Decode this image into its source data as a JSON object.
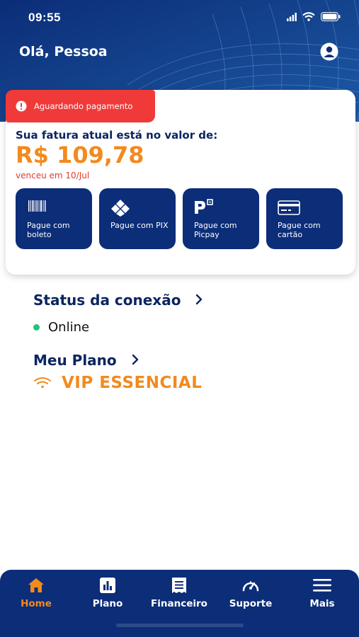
{
  "status_bar": {
    "time": "09:55"
  },
  "header": {
    "greeting": "Olá, Pessoa",
    "profile_icon": "user-icon"
  },
  "invoice": {
    "badge": "Aguardando pagamento",
    "label": "Sua fatura atual está no valor de:",
    "amount": "R$ 109,78",
    "due": "venceu em 10/Jul"
  },
  "payment_options": [
    {
      "label": "Pague com boleto",
      "icon": "barcode-icon"
    },
    {
      "label": "Pague com PIX",
      "icon": "pix-icon"
    },
    {
      "label": "Pague com Picpay",
      "icon": "picpay-icon"
    },
    {
      "label": "Pague com cartão",
      "icon": "credit-card-icon"
    }
  ],
  "connection": {
    "title": "Status da conexão",
    "status": "Online"
  },
  "plan": {
    "title": "Meu Plano",
    "name": "VIP ESSENCIAL"
  },
  "bottom_nav": [
    {
      "label": "Home",
      "icon": "home-icon",
      "active": true
    },
    {
      "label": "Plano",
      "icon": "chart-icon"
    },
    {
      "label": "Financeiro",
      "icon": "receipt-icon"
    },
    {
      "label": "Suporte",
      "icon": "speedometer-icon"
    },
    {
      "label": "Mais",
      "icon": "menu-icon"
    }
  ],
  "colors": {
    "brand_blue": "#0c2d78",
    "accent_orange": "#f28a1e",
    "alert_red": "#f03a3a",
    "online_green": "#22c37e"
  }
}
